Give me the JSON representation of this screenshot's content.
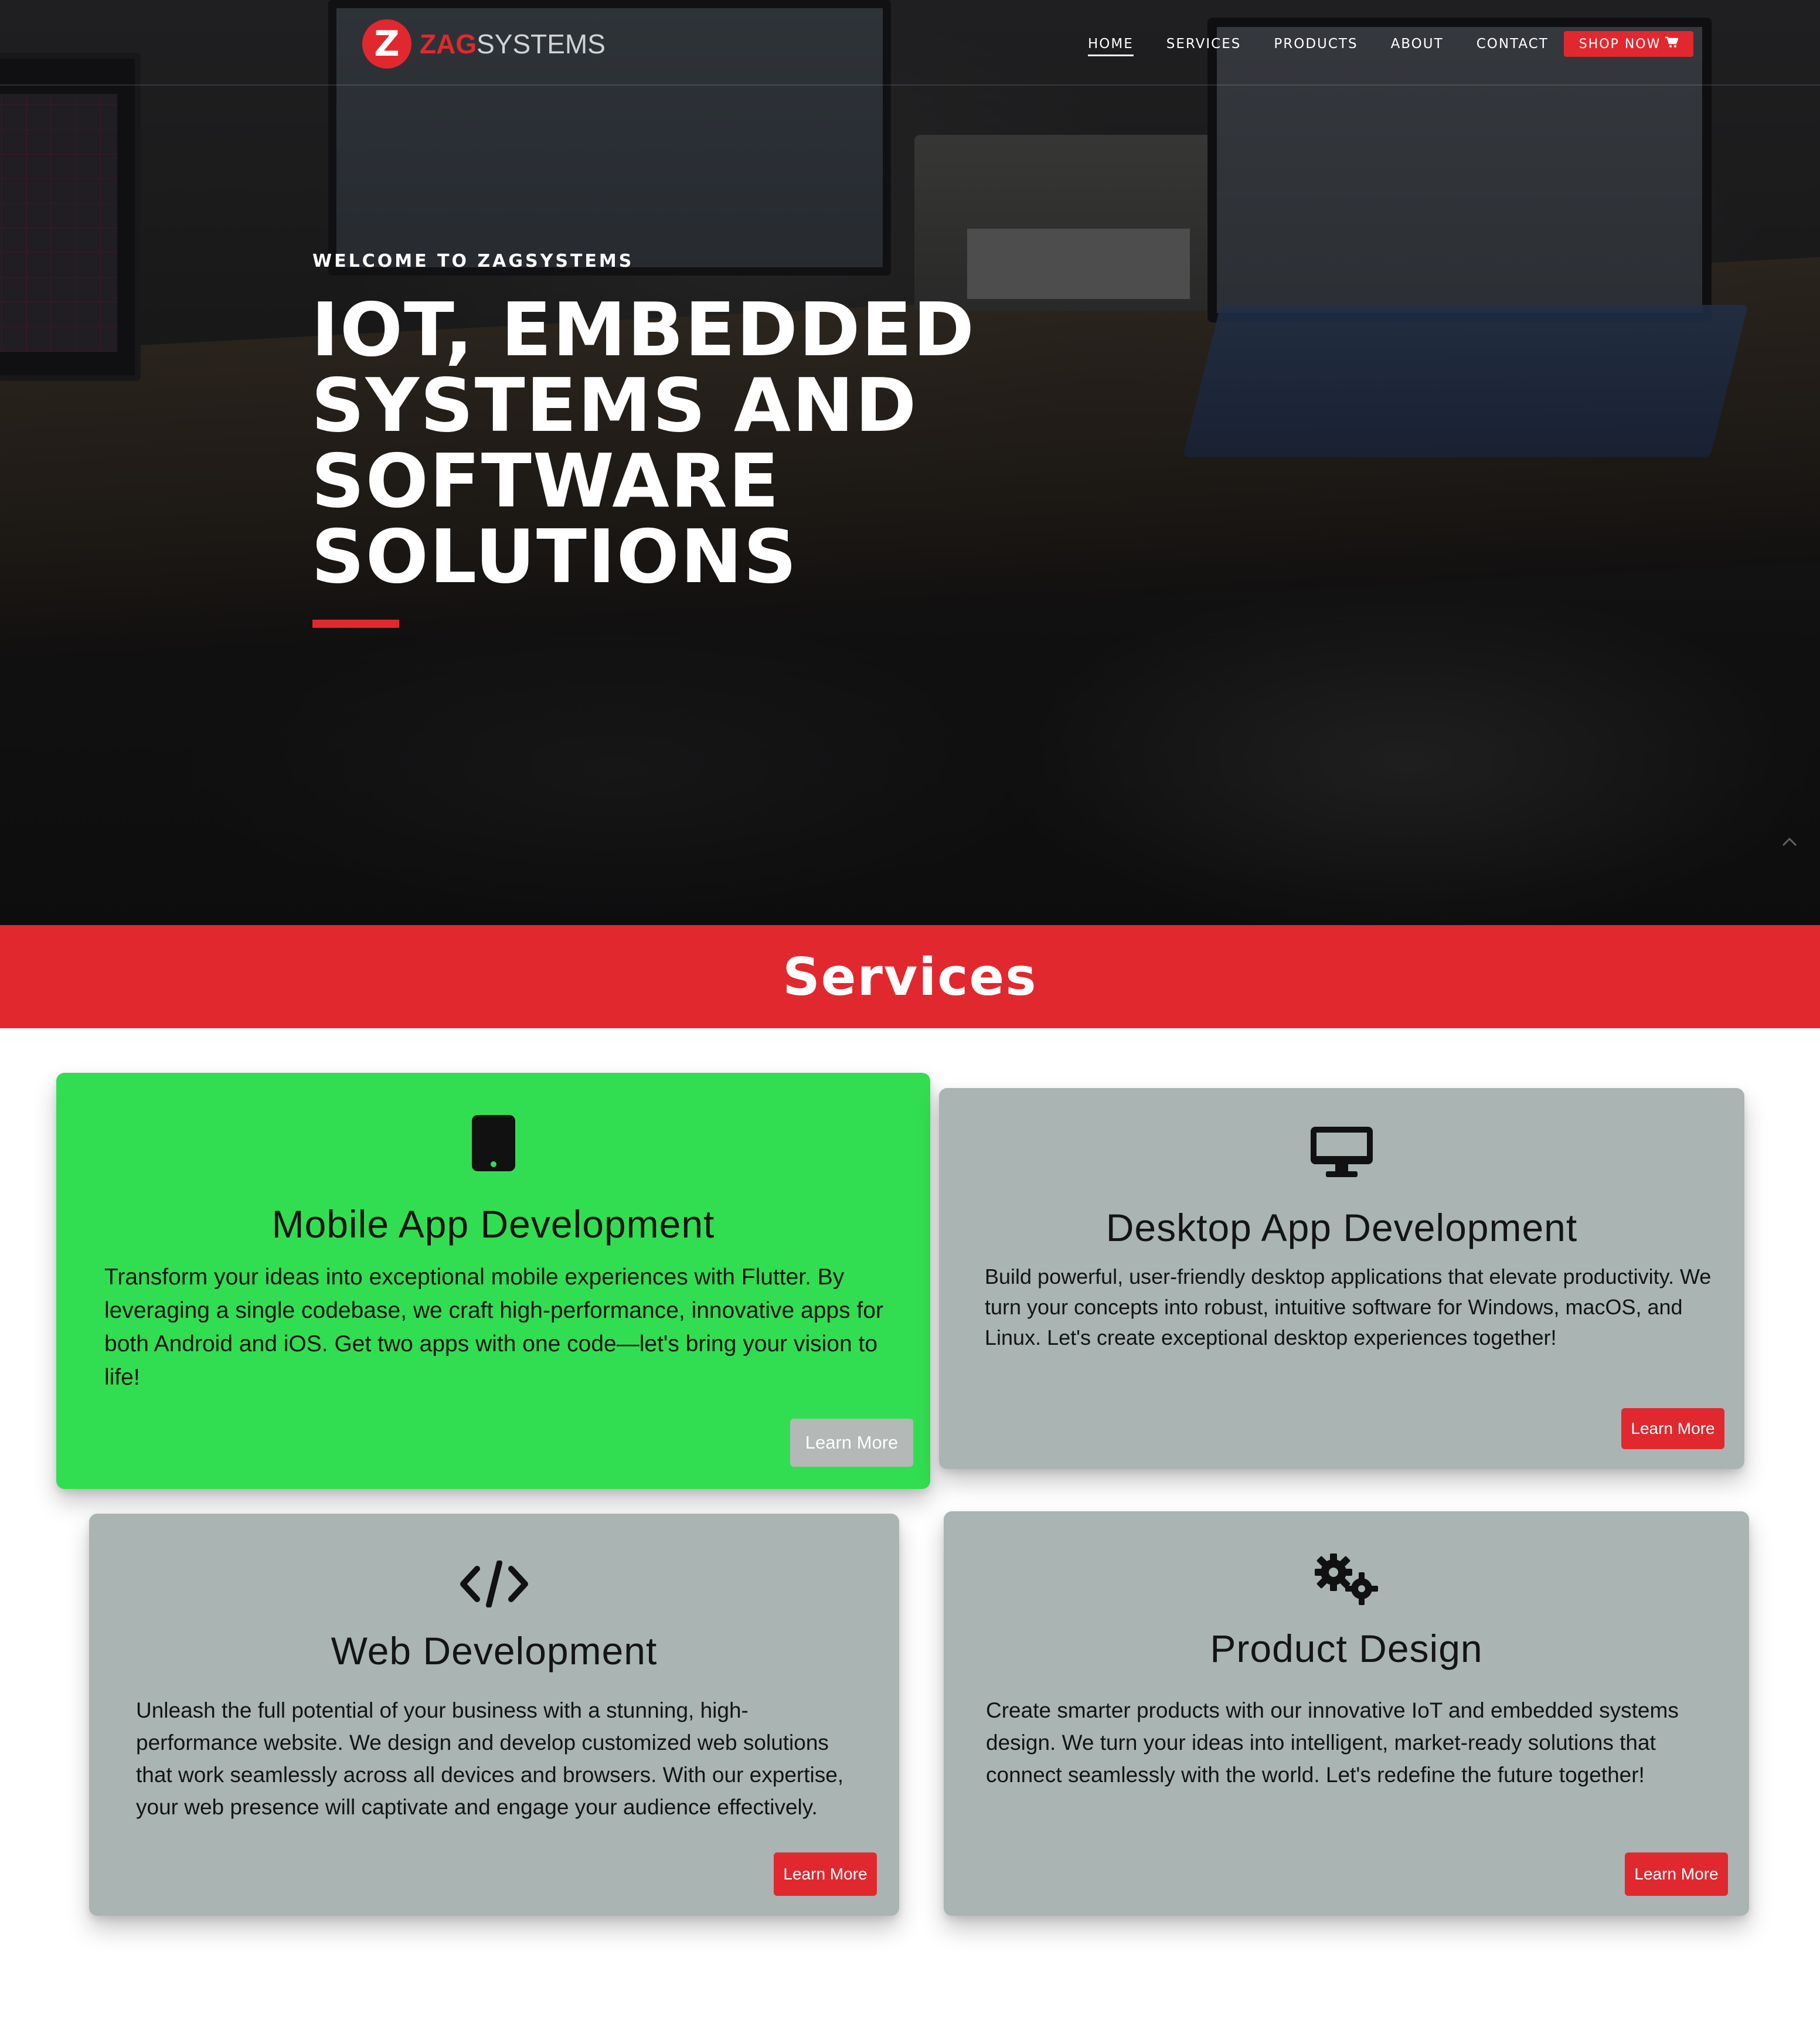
{
  "brand": {
    "logo_letter": "Z",
    "name_accent": "ZAG",
    "name_rest": "SYSTEMS",
    "accent_color": "#e1282f"
  },
  "nav": {
    "items": [
      {
        "label": "HOME",
        "active": true
      },
      {
        "label": "SERVICES",
        "active": false
      },
      {
        "label": "PRODUCTS",
        "active": false
      },
      {
        "label": "ABOUT",
        "active": false
      },
      {
        "label": "CONTACT",
        "active": false
      }
    ],
    "shop_label": "SHOP NOW",
    "shop_icon": "cart-icon"
  },
  "hero": {
    "welcome": "WELCOME TO ZAGSYSTEMS",
    "title_lines": [
      "IOT, EMBEDDED",
      "SYSTEMS AND",
      "SOFTWARE",
      "SOLUTIONS"
    ],
    "scroll_icon": "chevron-up-icon"
  },
  "services": {
    "heading": "Services",
    "cards": [
      {
        "icon": "tablet-icon",
        "title": "Mobile App Development",
        "description": "Transform your ideas into exceptional mobile experiences with Flutter. By leveraging a single codebase, we craft high-performance, innovative apps for both Android and iOS. Get two apps with one code—let's bring your vision to life!",
        "button": "Learn More",
        "highlight_color": "#32de51"
      },
      {
        "icon": "desktop-icon",
        "title": "Desktop App Development",
        "description": "Build powerful, user-friendly desktop applications that elevate productivity. We turn your concepts into robust, intuitive software for Windows, macOS, and Linux. Let's create exceptional desktop experiences together!",
        "button": "Learn More"
      },
      {
        "icon": "code-icon",
        "title": "Web Development",
        "description": "Unleash the full potential of your business with a stunning, high-performance website. We design and develop customized web solutions that work seamlessly across all devices and browsers. With our expertise, your web presence will captivate and engage your audience effectively.",
        "button": "Learn More"
      },
      {
        "icon": "gears-icon",
        "title": "Product Design",
        "description": "Create smarter products with our innovative IoT and embedded systems design. We turn your ideas into intelligent, market-ready solutions that connect seamlessly with the world. Let's redefine the future together!",
        "button": "Learn More"
      }
    ]
  }
}
